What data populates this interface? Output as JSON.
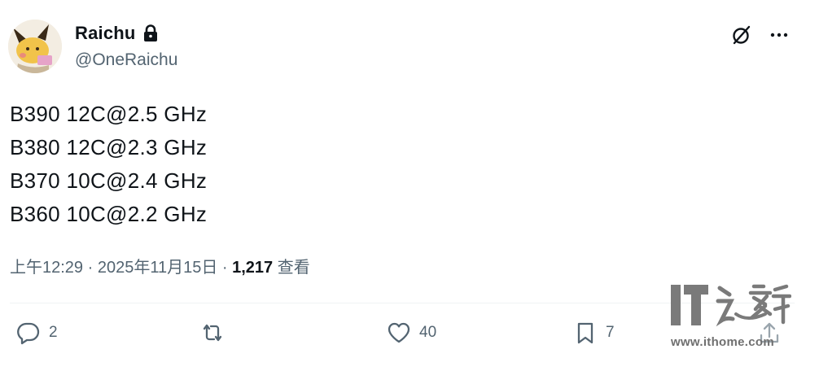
{
  "post": {
    "author": {
      "display_name": "Raichu",
      "handle": "@OneRaichu",
      "protected_icon": "lock-icon"
    },
    "header_actions": [
      {
        "icon": "grok-icon"
      },
      {
        "icon": "more-icon"
      }
    ],
    "lines": [
      "B390 12C@2.5 GHz",
      "B380 12C@2.3 GHz",
      "B370 10C@2.4 GHz",
      "B360 10C@2.2 GHz"
    ],
    "meta": {
      "time": "上午12:29",
      "separator": " · ",
      "date": "2025年11月15日",
      "views_count": "1,217",
      "views_label": " 查看"
    },
    "actions": {
      "reply": {
        "icon": "reply-icon",
        "count": "2"
      },
      "repost": {
        "icon": "repost-icon",
        "count": ""
      },
      "like": {
        "icon": "heart-icon",
        "count": "40"
      },
      "bookmark": {
        "icon": "bookmark-icon",
        "count": "7"
      },
      "share": {
        "icon": "share-icon"
      }
    }
  },
  "watermark": {
    "url": "www.ithome.com",
    "logo_text": "IT之家"
  },
  "colors": {
    "text": "#0f1419",
    "secondary": "#536471",
    "divider": "#eff3f4",
    "watermark": "#7a7a7a"
  }
}
